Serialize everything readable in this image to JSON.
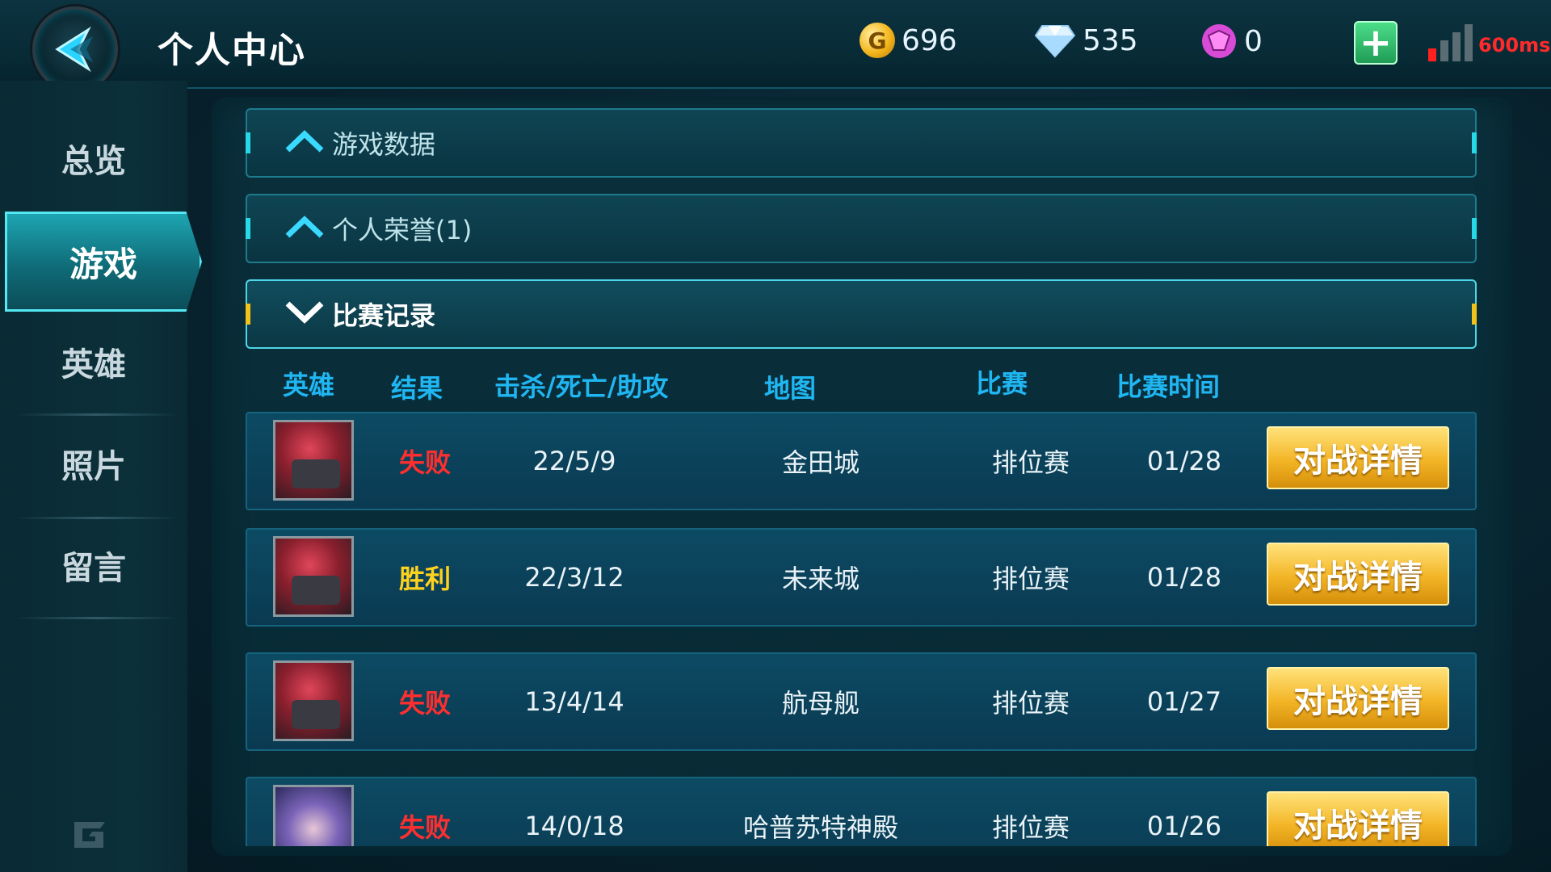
{
  "header": {
    "title": "个人中心",
    "gold": "696",
    "gold_symbol": "G",
    "diamonds": "535",
    "gems": "0",
    "plus_label": "+",
    "ping": "600ms"
  },
  "sidebar": {
    "items": [
      {
        "label": "总览"
      },
      {
        "label": "游戏"
      },
      {
        "label": "英雄"
      },
      {
        "label": "照片"
      },
      {
        "label": "留言"
      }
    ],
    "active_index": 1
  },
  "sections": [
    {
      "label": "游戏数据",
      "expanded": false
    },
    {
      "label": "个人荣誉(1)",
      "expanded": false
    },
    {
      "label": "比赛记录",
      "expanded": true
    }
  ],
  "table": {
    "headers": [
      "英雄",
      "结果",
      "击杀/死亡/助攻",
      "地图",
      "比赛",
      "比赛时间"
    ],
    "rows": [
      {
        "result": "失败",
        "kda": "22/5/9",
        "map": "金田城",
        "match": "排位赛",
        "time": "01/28",
        "action": "对战详情"
      },
      {
        "result": "胜利",
        "kda": "22/3/12",
        "map": "未来城",
        "match": "排位赛",
        "time": "01/28",
        "action": "对战详情"
      },
      {
        "result": "失败",
        "kda": "13/4/14",
        "map": "航母舰",
        "match": "排位赛",
        "time": "01/27",
        "action": "对战详情"
      },
      {
        "result": "失败",
        "kda": "14/0/18",
        "map": "哈普苏特神殿",
        "match": "排位赛",
        "time": "01/26",
        "action": "对战详情"
      }
    ]
  },
  "colors": {
    "accent": "#1fb6f2",
    "lose": "#ff2f2f",
    "win": "#ffd21e",
    "button": "#f3b526"
  }
}
